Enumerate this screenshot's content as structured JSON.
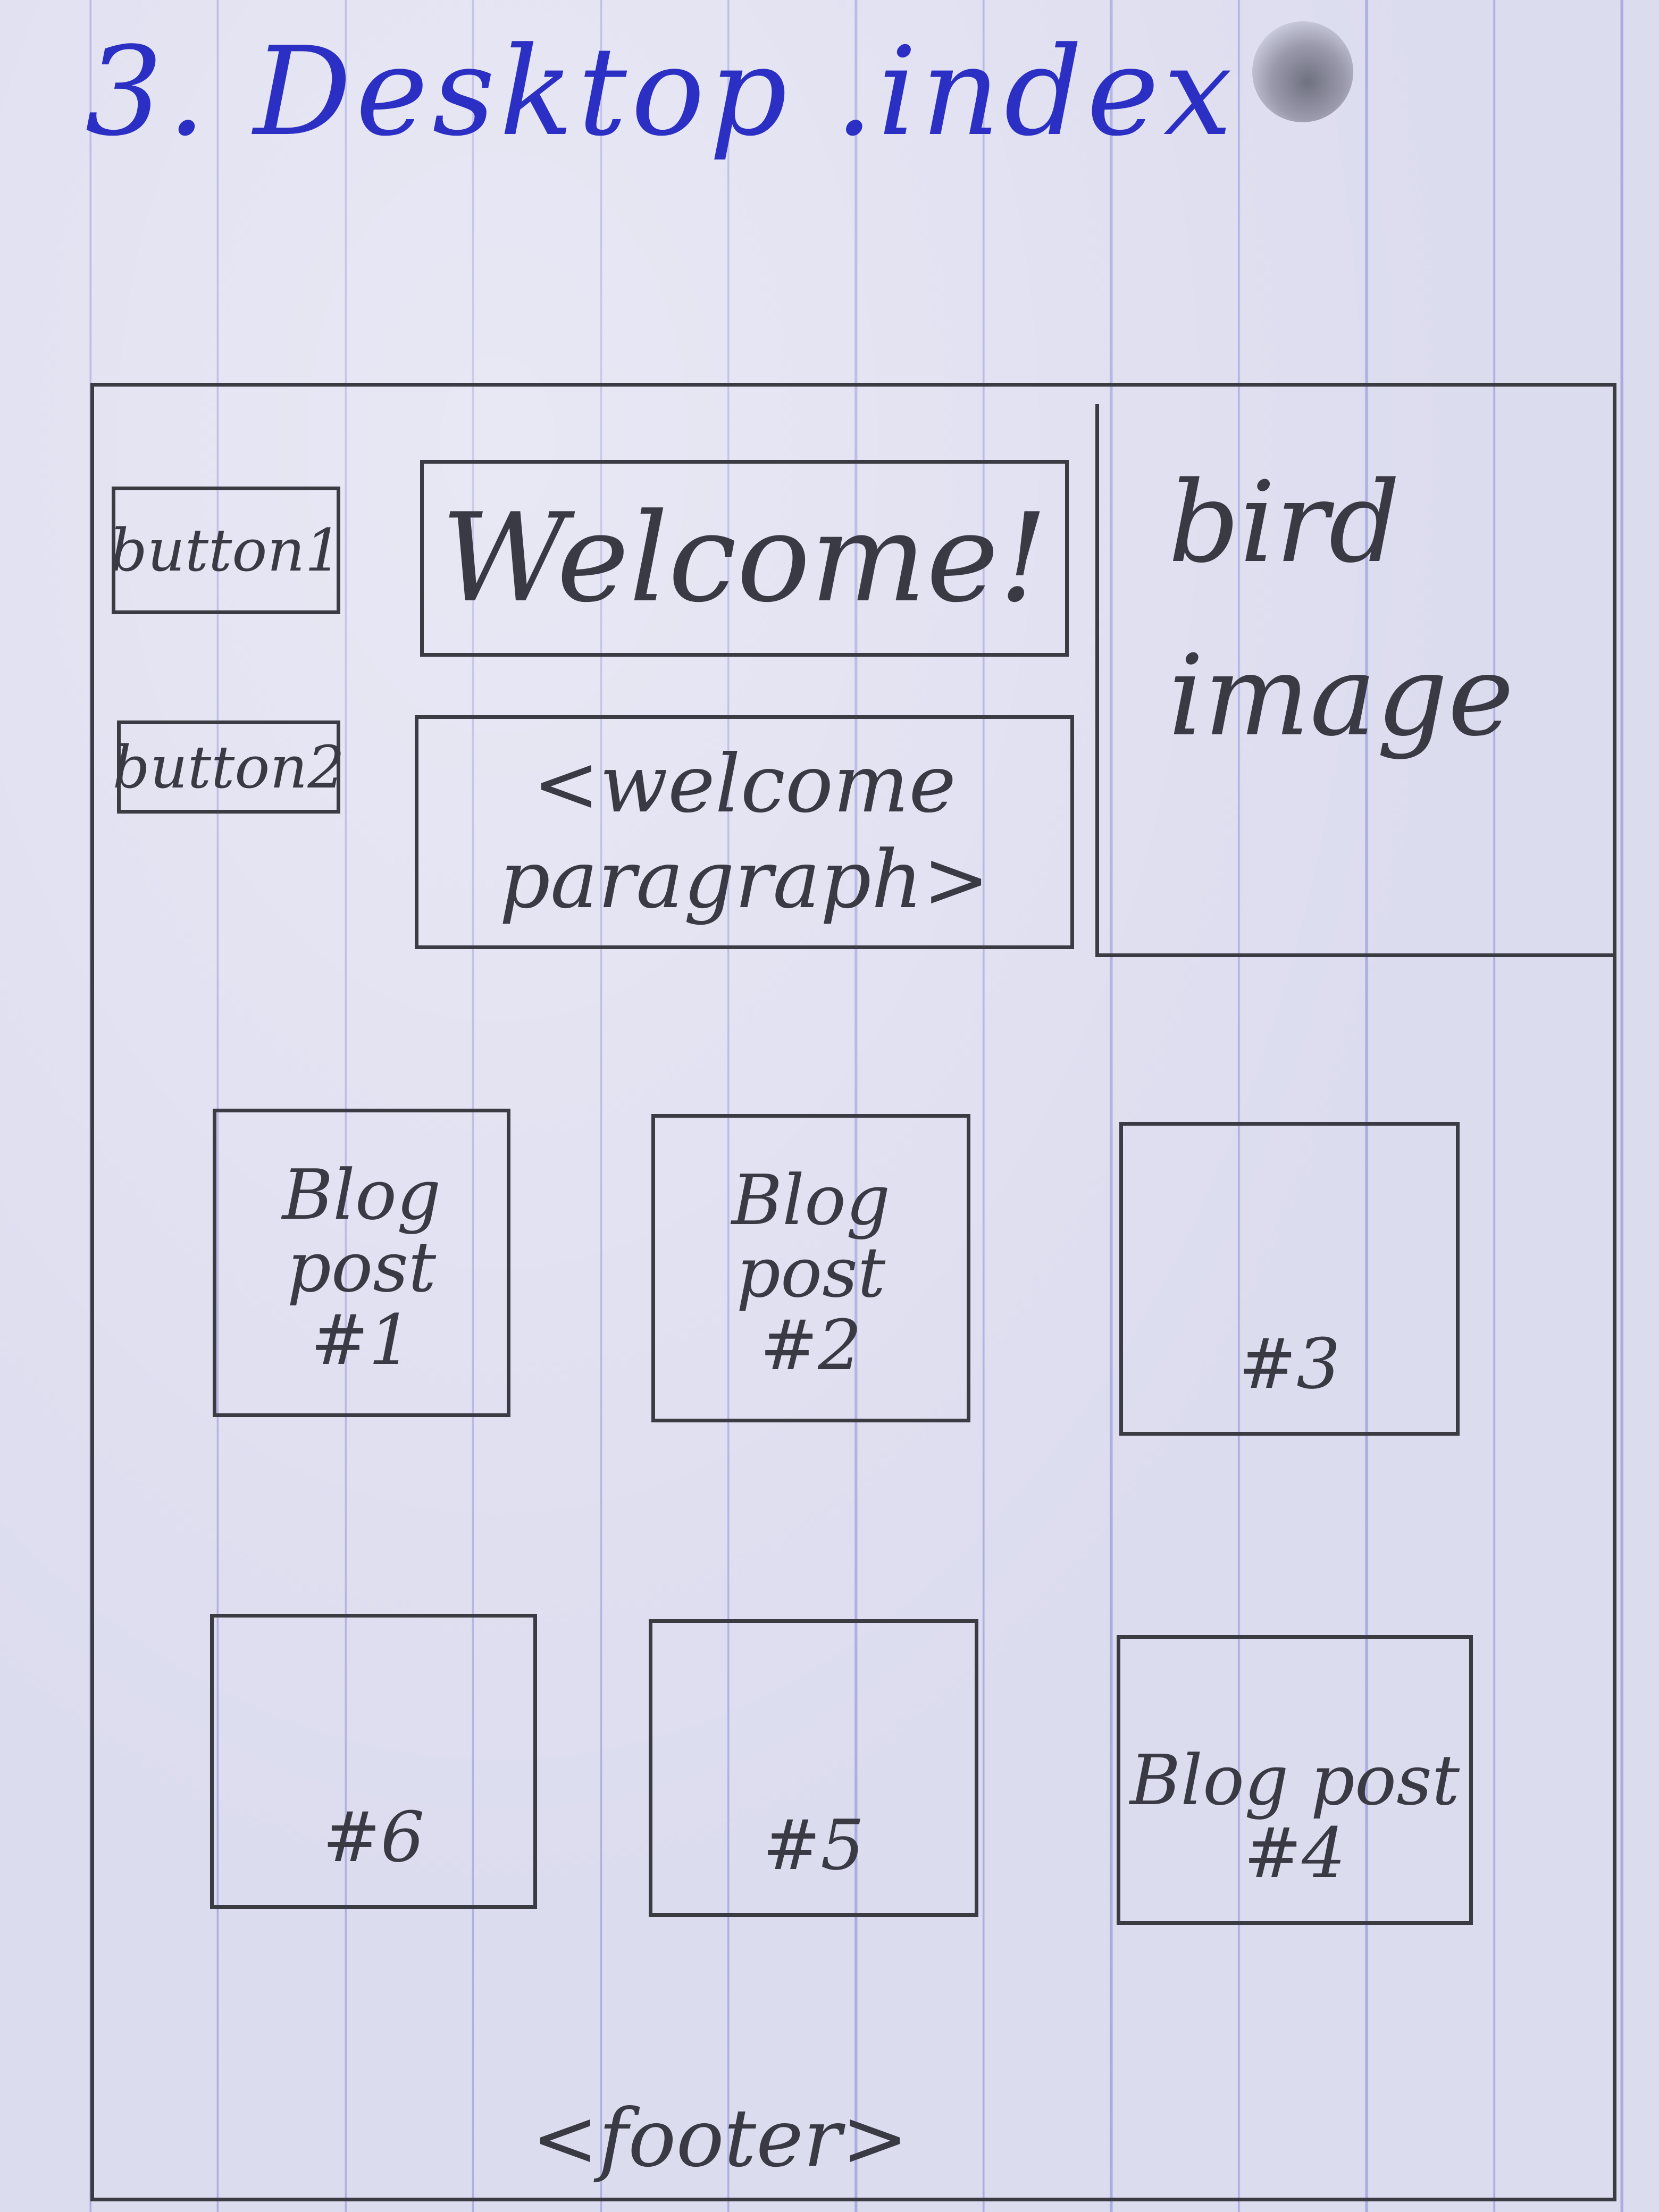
{
  "page_title": "3. Desktop .index",
  "header": {
    "button1_label": "button1",
    "button2_label": "button2",
    "welcome_heading": "Welcome!",
    "welcome_paragraph": "<welcome paragraph>"
  },
  "bird_image_label": "bird image",
  "blog_posts": [
    {
      "label": "Blog\npost\n#1"
    },
    {
      "label": "Blog\npost\n#2"
    },
    {
      "label": "#3"
    },
    {
      "label": "Blog post\n#4"
    },
    {
      "label": "#5"
    },
    {
      "label": "#6"
    }
  ],
  "footer_label": "<footer>"
}
